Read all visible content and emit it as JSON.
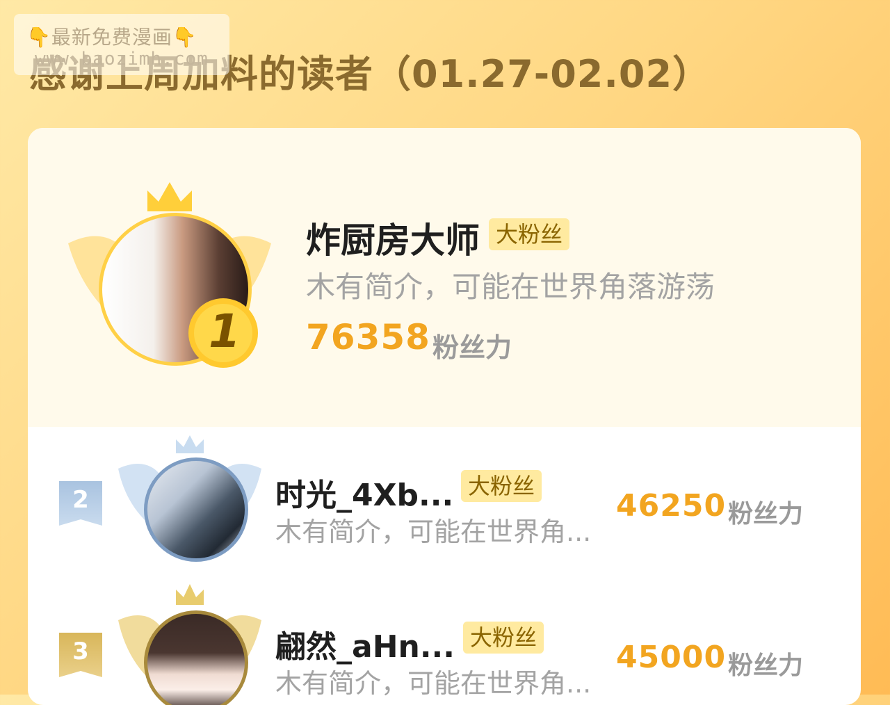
{
  "watermark": {
    "line1": "最新免费漫画",
    "line2": "www.baozimh.com"
  },
  "page_title": "感谢上周加料的读者（01.27-02.02）",
  "colors": {
    "accent": "#f2a520",
    "badge_bg": "#ffeaa0",
    "gold": "#ffd23e",
    "silver": "#a9c3e0",
    "bronze": "#d9b85e"
  },
  "readers": [
    {
      "rank": "1",
      "name": "炸厨房大师",
      "badge": "大粉丝",
      "bio": "木有简介，可能在世界角落游荡",
      "score": "76358",
      "score_unit": "粉丝力"
    },
    {
      "rank": "2",
      "name": "时光_4Xb...",
      "badge": "大粉丝",
      "bio": "木有简介，可能在世界角...",
      "score": "46250",
      "score_unit": "粉丝力"
    },
    {
      "rank": "3",
      "name": "翩然_aHn...",
      "badge": "大粉丝",
      "bio": "木有简介，可能在世界角...",
      "score": "45000",
      "score_unit": "粉丝力"
    }
  ]
}
